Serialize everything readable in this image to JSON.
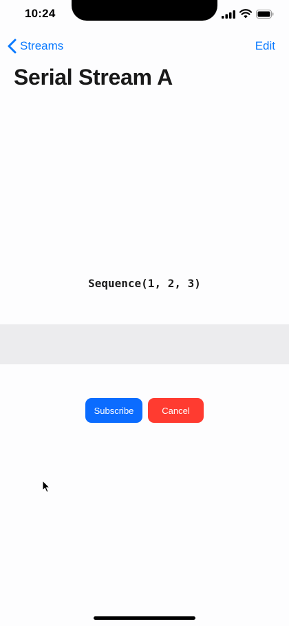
{
  "status_bar": {
    "time": "10:24",
    "icons": [
      "signal-icon",
      "wifi-icon",
      "battery-icon"
    ]
  },
  "nav": {
    "back_label": "Streams",
    "back_icon": "chevron-left-icon",
    "edit_label": "Edit",
    "accent_color": "#0a7aff"
  },
  "page": {
    "title": "Serial Stream A"
  },
  "content": {
    "sequence": "Sequence(1, 2, 3)"
  },
  "actions": {
    "subscribe_label": "Subscribe",
    "subscribe_color": "#0b6cff",
    "cancel_label": "Cancel",
    "cancel_color": "#ff3b30"
  }
}
